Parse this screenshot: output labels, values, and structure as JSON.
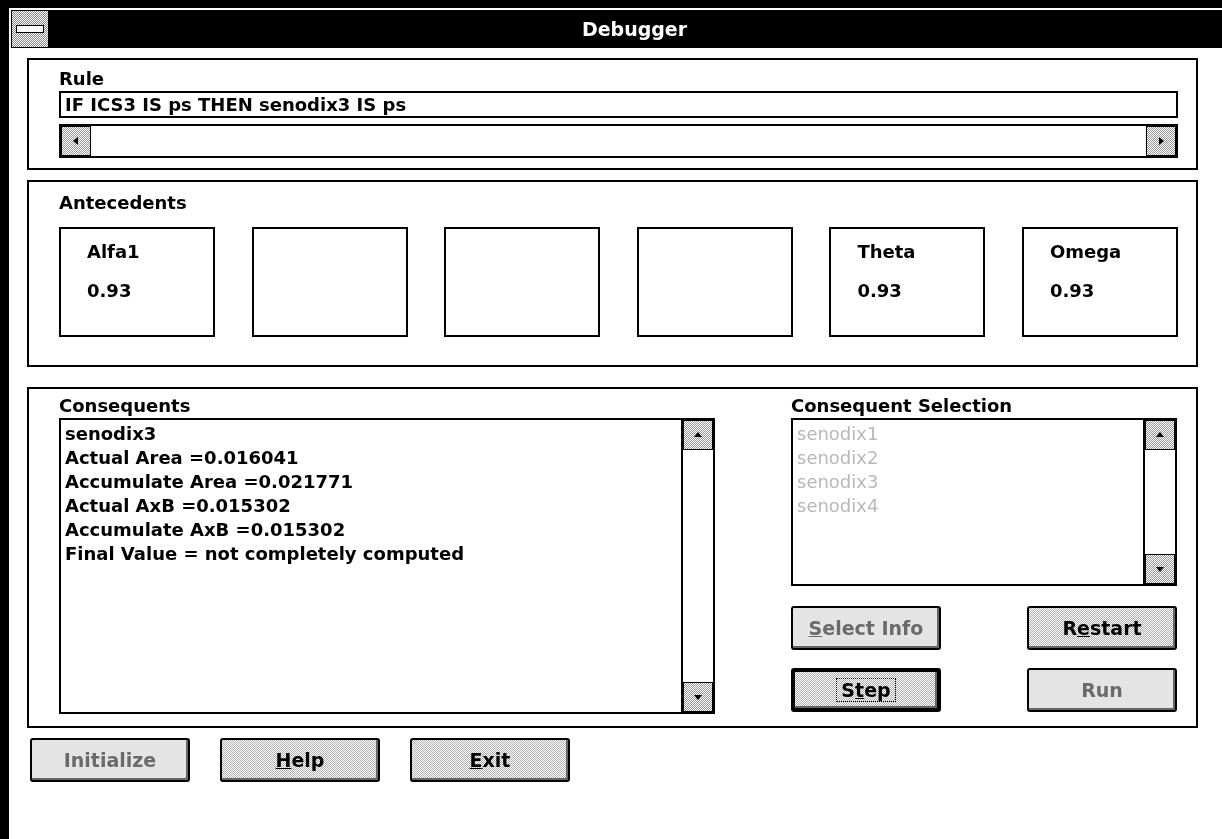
{
  "window": {
    "title": "Debugger"
  },
  "rule": {
    "label": "Rule",
    "value": "IF ICS3 IS ps THEN senodix3 IS ps"
  },
  "antecedents": {
    "label": "Antecedents",
    "items": [
      {
        "kind": "filled",
        "name": "Alfa1",
        "value": "0.93"
      },
      {
        "kind": "empty"
      },
      {
        "kind": "empty"
      },
      {
        "kind": "empty"
      },
      {
        "kind": "filled",
        "name": "Theta",
        "value": "0.93"
      },
      {
        "kind": "filled",
        "name": "Omega",
        "value": "0.93"
      }
    ]
  },
  "consequents": {
    "label": "Consequents",
    "lines": [
      "senodix3",
      "Actual Area =0.016041",
      "Accumulate Area =0.021771",
      "Actual AxB =0.015302",
      "Accumulate AxB =0.015302",
      "Final Value = not completely computed"
    ]
  },
  "consequent_selection": {
    "label": "Consequent Selection",
    "disabled": true,
    "items": [
      "senodix1",
      "senodix2",
      "senodix3",
      "senodix4"
    ]
  },
  "selection_buttons": [
    {
      "key": "S",
      "post": "elect Info",
      "disabled": true,
      "default": false
    },
    {
      "pre": "R",
      "key": "e",
      "post": "start",
      "disabled": false,
      "default": false
    },
    {
      "pre": "S",
      "key": "t",
      "post": "ep",
      "disabled": false,
      "default": true
    },
    {
      "pre": "Run",
      "disabled": true,
      "default": false
    }
  ],
  "footer_buttons": [
    {
      "pre": "Initialize",
      "disabled": true,
      "default": false
    },
    {
      "key": "H",
      "post": "elp",
      "disabled": false,
      "default": false
    },
    {
      "key": "E",
      "post": "xit",
      "disabled": false,
      "default": false
    }
  ]
}
